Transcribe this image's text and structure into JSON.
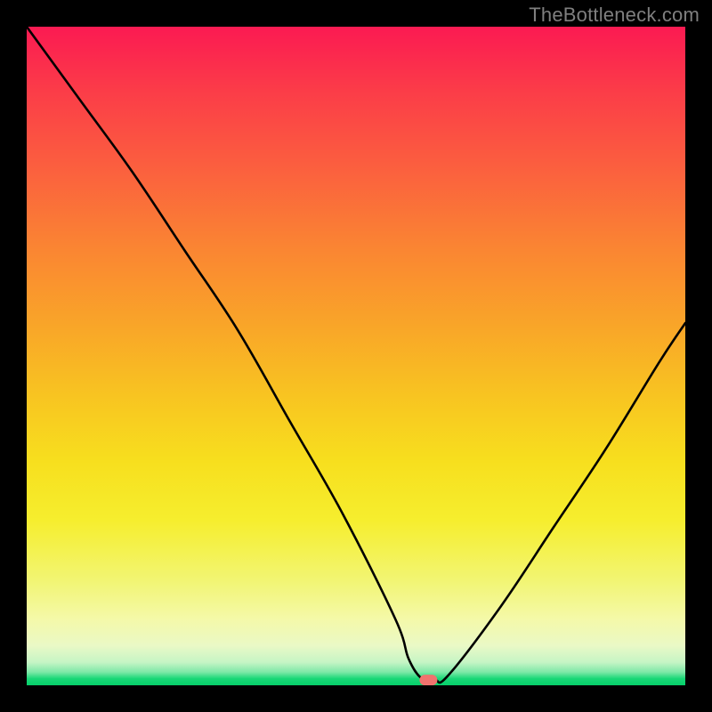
{
  "attribution": "TheBottleneck.com",
  "chart_data": {
    "type": "line",
    "title": "",
    "xlabel": "",
    "ylabel": "",
    "xlim": [
      0,
      100
    ],
    "ylim": [
      0,
      100
    ],
    "x": [
      0,
      8,
      16,
      24,
      32,
      40,
      48,
      56,
      58,
      60,
      62,
      64,
      72,
      80,
      88,
      96,
      100
    ],
    "values": [
      100,
      89,
      78,
      66,
      54,
      40,
      26,
      10,
      4,
      1,
      0.8,
      1.5,
      12,
      24,
      36,
      49,
      55
    ],
    "marker": {
      "x": 61,
      "y": 0.8,
      "color": "#f0736e"
    },
    "gradient_stops": [
      {
        "pos": 0,
        "color": "#fb1a52"
      },
      {
        "pos": 10,
        "color": "#fb3d48"
      },
      {
        "pos": 22,
        "color": "#fb613e"
      },
      {
        "pos": 34,
        "color": "#fa8632"
      },
      {
        "pos": 46,
        "color": "#f9a728"
      },
      {
        "pos": 56,
        "color": "#f8c421"
      },
      {
        "pos": 66,
        "color": "#f7df1e"
      },
      {
        "pos": 75,
        "color": "#f6ee2e"
      },
      {
        "pos": 84,
        "color": "#f2f572"
      },
      {
        "pos": 90,
        "color": "#f4f9a9"
      },
      {
        "pos": 94,
        "color": "#eaf9c6"
      },
      {
        "pos": 96.5,
        "color": "#c6f5c5"
      },
      {
        "pos": 98,
        "color": "#7de8a7"
      },
      {
        "pos": 99,
        "color": "#18d776"
      },
      {
        "pos": 100,
        "color": "#06cf6a"
      }
    ]
  }
}
